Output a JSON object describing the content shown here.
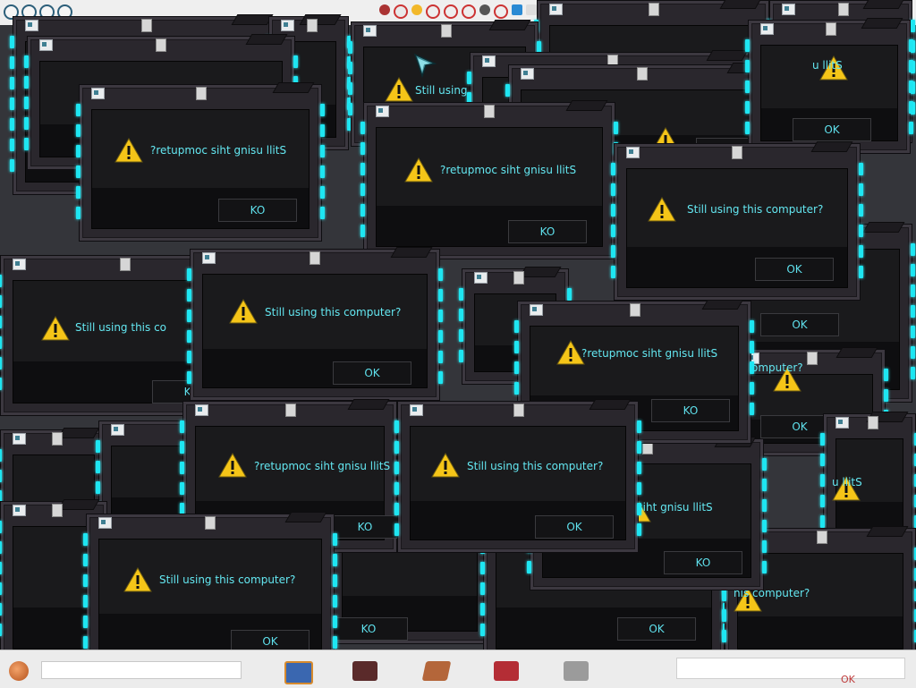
{
  "dialog_messages": {
    "normal": "Still using this computer?",
    "reversed": "?retupmoc siht gnisu llitS",
    "partial_a": "Still using",
    "partial_b": "Still using this co",
    "partial_c": "c siht gnisu llitS",
    "partial_d": "u llitS",
    "partial_e": "omputer?",
    "partial_f": "his computer?",
    "partial_g": "Still using this computer?",
    "partial_h": "?retupmoc siht gnisu llitS"
  },
  "buttons": {
    "ok": "OK",
    "ok_reversed": "KO"
  },
  "colors": {
    "accent_cyan": "#1ee6f2",
    "text_cyan": "#63e6f0",
    "frame": "#2a272d",
    "desktop": "#34353a",
    "warning_yellow": "#f5c518"
  },
  "icons": {
    "warning": "warning-icon",
    "app": "window-app-icon",
    "cursor": "arrow-cursor-icon",
    "start": "start-orb-icon"
  },
  "taskbar": {
    "clock_text": "OK"
  }
}
